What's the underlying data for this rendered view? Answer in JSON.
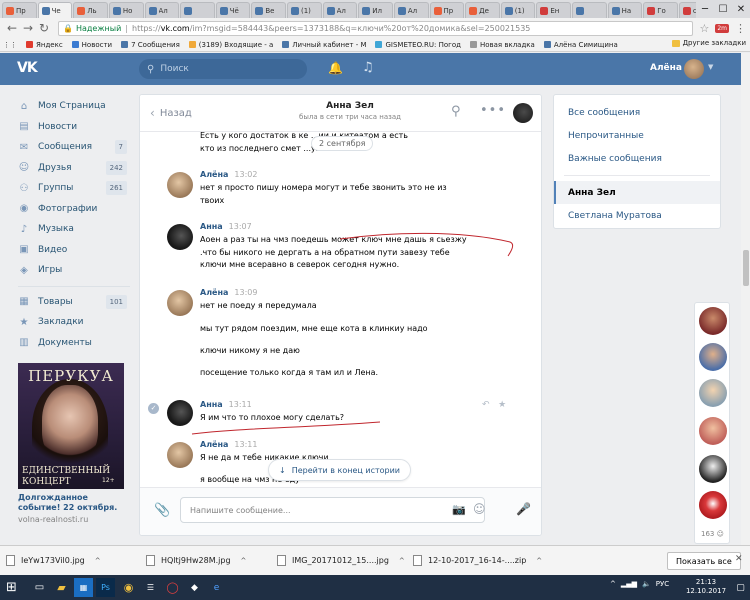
{
  "browser": {
    "tabs": [
      {
        "title": "Пр",
        "color": "#e95f3a"
      },
      {
        "title": "Че",
        "color": "#4a76a8"
      },
      {
        "title": "Ль",
        "color": "#e95f3a"
      },
      {
        "title": "Но",
        "color": "#4a76a8"
      },
      {
        "title": "Ал",
        "color": "#4a76a8"
      },
      {
        "title": "",
        "color": "#4a76a8"
      },
      {
        "title": "Чё",
        "color": "#4a76a8"
      },
      {
        "title": "Ве",
        "color": "#4a76a8"
      },
      {
        "title": "(1)",
        "color": "#4a76a8"
      },
      {
        "title": "Ал",
        "color": "#4a76a8"
      },
      {
        "title": "Ил",
        "color": "#4a76a8"
      },
      {
        "title": "Ал",
        "color": "#4a76a8"
      },
      {
        "title": "Пр",
        "color": "#e95f3a"
      },
      {
        "title": "Де",
        "color": "#e95f3a"
      },
      {
        "title": "(1)",
        "color": "#4a76a8"
      },
      {
        "title": "Ен",
        "color": "#d13c3c"
      },
      {
        "title": "",
        "color": "#4a76a8"
      },
      {
        "title": "На",
        "color": "#4a76a8"
      },
      {
        "title": "Го",
        "color": "#d13c3c"
      },
      {
        "title": "су",
        "color": "#d13c3c"
      },
      {
        "title": "Сп",
        "color": "#d13c3c"
      }
    ],
    "address": {
      "secure_label": "Надежный",
      "protocol": "https://",
      "host": "vk.com",
      "path": "/im?msgid=584443&peers=1373188&q=ключи%20от%20домика&sel=250021535"
    },
    "extension_badge": "2m",
    "bookmarks": [
      {
        "label": "Яндекс",
        "color": "#e03b2e"
      },
      {
        "label": "Новости",
        "color": "#3b7bd1"
      },
      {
        "label": "7 Сообщения",
        "color": "#4a76a8"
      },
      {
        "label": "(3189) Входящие - а",
        "color": "#f0a93a"
      },
      {
        "label": "Личный кабинет - М",
        "color": "#4a76a8"
      },
      {
        "label": "GISMETEO.RU: Погод",
        "color": "#3fa6d6"
      },
      {
        "label": "Новая вкладка",
        "color": "#999999"
      },
      {
        "label": "Алёна Симищина",
        "color": "#4a76a8"
      }
    ],
    "bookmarks_other": "Другие закладки"
  },
  "header": {
    "search_placeholder": "Поиск",
    "user_name": "Алёна"
  },
  "left_menu": {
    "items": [
      {
        "icon": "⌂",
        "label": "Моя Страница",
        "count": ""
      },
      {
        "icon": "▤",
        "label": "Новости",
        "count": ""
      },
      {
        "icon": "✉",
        "label": "Сообщения",
        "count": "7"
      },
      {
        "icon": "☺",
        "label": "Друзья",
        "count": "242"
      },
      {
        "icon": "⚇",
        "label": "Группы",
        "count": "261"
      },
      {
        "icon": "◉",
        "label": "Фотографии",
        "count": ""
      },
      {
        "icon": "♪",
        "label": "Музыка",
        "count": ""
      },
      {
        "icon": "▣",
        "label": "Видео",
        "count": ""
      },
      {
        "icon": "◈",
        "label": "Игры",
        "count": ""
      }
    ],
    "items2": [
      {
        "icon": "▦",
        "label": "Товары",
        "count": "101"
      },
      {
        "icon": "★",
        "label": "Закладки",
        "count": ""
      },
      {
        "icon": "▥",
        "label": "Документы",
        "count": ""
      }
    ]
  },
  "ad": {
    "title": "ПЕРУКУА",
    "line1": "ЕДИНСТВЕННЫЙ",
    "line2": "КОНЦЕРТ",
    "age": "12+",
    "caption": "Долгожданное событие! 22 октября.",
    "link": "volna-realnosti.ru"
  },
  "chat": {
    "back_label": "Назад",
    "peer_name": "Анна Зел",
    "peer_status": "была в сети три часа назад",
    "date_badge": "2 сентября",
    "messages": [
      {
        "text": "Есть у кого достаток в ке      ...ии и китеатом а есть"
      },
      {
        "text": "кто из последнего смет          ...упать."
      },
      {
        "sender": "Алёна",
        "time": "13:02",
        "lines": [
          "нет я просто пишу номера могут и тебе звонить это не из",
          "твоих"
        ]
      },
      {
        "sender": "Анна",
        "time": "13:07",
        "lines": [
          "Аоен а раз ты на чмз поедешь может ключ мне дашь я сьезжу",
          ".что бы никого не дергать а на обратном пути завезу тебе",
          "ключи мне всеравно в северок сегодня нужно."
        ]
      },
      {
        "sender": "Алёна",
        "time": "13:09",
        "lines": [
          "нет не поеду я передумала",
          "мы тут рядом поездим, мне еще кота в клинкиу надо",
          "ключи никому я не даю",
          "посещение только когда я там ил и Лена."
        ]
      },
      {
        "sender": "Анна",
        "time": "13:11",
        "lines": [
          "Я им что то плохое могу сделать?"
        ]
      },
      {
        "sender": "Алёна",
        "time": "13:11",
        "lines": [
          "Я не да м тебе никакие ключи",
          "я вообще на чмз не еду"
        ]
      }
    ],
    "jump_label": "Перейти в конец истории",
    "compose_placeholder": "Напишите сообщение..."
  },
  "right_menu": {
    "all": "Все сообщения",
    "unread": "Непрочитанные",
    "important": "Важные сообщения",
    "selected": "Анна Зел",
    "other": "Светлана Муратова"
  },
  "friends_online_count": "163",
  "downloads": {
    "files": [
      {
        "name": "IeYw173Vil0.jpg"
      },
      {
        "name": "HQltj9Hw28M.jpg"
      },
      {
        "name": "IMG_20171012_15....jpg"
      },
      {
        "name": "12-10-2017_16-14-....zip"
      }
    ],
    "show_all": "Показать все"
  },
  "taskbar": {
    "lang": "РУС",
    "time": "21:13",
    "date": "12.10.2017"
  }
}
